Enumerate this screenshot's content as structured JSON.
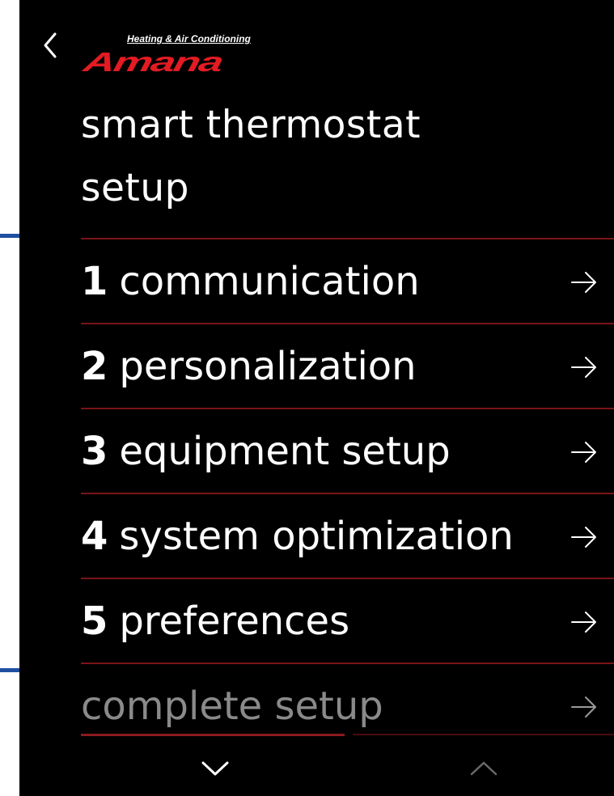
{
  "header": {
    "back_icon": "chevron-left-icon",
    "logo": {
      "tagline": "Heating & Air Conditioning",
      "wordmark": "Amana",
      "brand_color": "#e31b23"
    },
    "title": "smart thermostat setup"
  },
  "menu": {
    "items": [
      {
        "number": "1",
        "label": "communication",
        "icon": "arrow-right-icon",
        "enabled": true
      },
      {
        "number": "2",
        "label": "personalization",
        "icon": "arrow-right-icon",
        "enabled": true
      },
      {
        "number": "3",
        "label": "equipment setup",
        "icon": "arrow-right-icon",
        "enabled": true
      },
      {
        "number": "4",
        "label": "system optimization",
        "icon": "arrow-right-icon",
        "enabled": true
      },
      {
        "number": "5",
        "label": "preferences",
        "icon": "arrow-right-icon",
        "enabled": true
      },
      {
        "number": "",
        "label": "complete setup",
        "icon": "arrow-right-icon",
        "enabled": false
      }
    ]
  },
  "footer": {
    "scroll_down_icon": "chevron-down-icon",
    "scroll_up_icon": "chevron-up-icon"
  },
  "colors": {
    "background": "#000000",
    "text": "#ffffff",
    "divider": "#7a1418",
    "disabled_text": "#8a8a8a",
    "side_marker": "#1f4fa0"
  }
}
